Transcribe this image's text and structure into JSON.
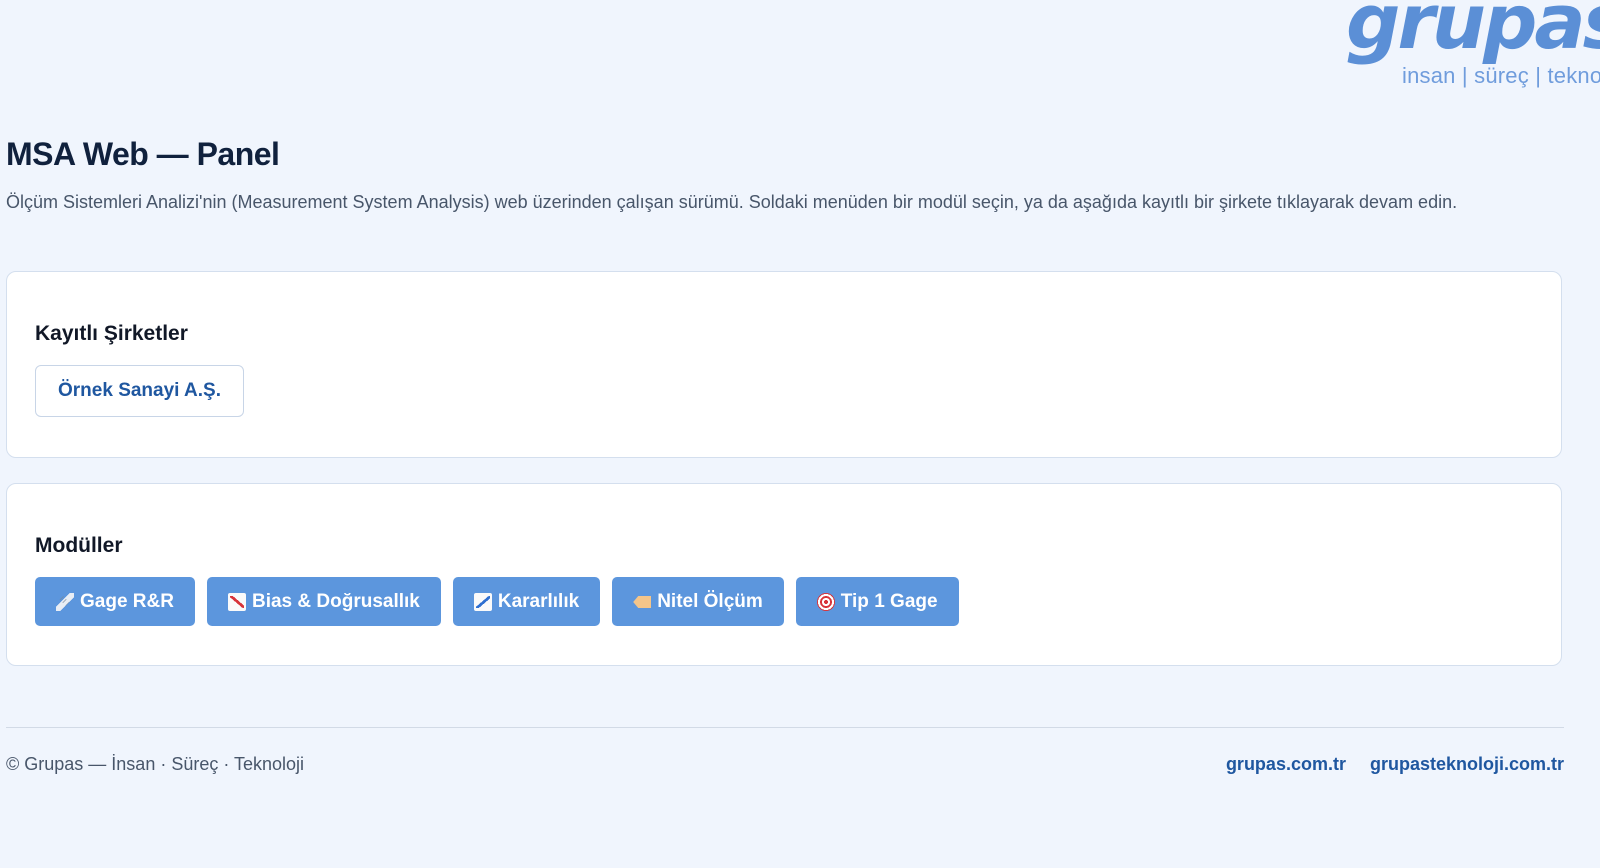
{
  "logo": {
    "wordmark": "grupas",
    "tagline": "insan | süreç | teknoloji",
    "color": "#5b8fd6"
  },
  "header": {
    "title": "MSA Web — Panel",
    "description": "Ölçüm Sistemleri Analizi'nin (Measurement System Analysis) web üzerinden çalışan sürümü. Soldaki menüden bir modül seçin, ya da aşağıda kayıtlı bir şirkete tıklayarak devam edin."
  },
  "companies": {
    "title": "Kayıtlı Şirketler",
    "items": [
      {
        "label": "Örnek Sanayi A.Ş."
      }
    ]
  },
  "modules": {
    "title": "Modüller",
    "accent_color": "#5c96dd",
    "items": [
      {
        "label": "Gage R&R",
        "icon": "ruler-icon"
      },
      {
        "label": "Bias & Doğrusallık",
        "icon": "chart-up-icon"
      },
      {
        "label": "Kararlılık",
        "icon": "chart-down-icon"
      },
      {
        "label": "Nitel Ölçüm",
        "icon": "tag-icon"
      },
      {
        "label": "Tip 1 Gage",
        "icon": "target-icon"
      }
    ]
  },
  "footer": {
    "copyright": "© Grupas — İnsan · Süreç · Teknoloji",
    "links": [
      {
        "label": "grupas.com.tr"
      },
      {
        "label": "grupasteknoloji.com.tr"
      }
    ],
    "link_color": "#1f57a0"
  }
}
